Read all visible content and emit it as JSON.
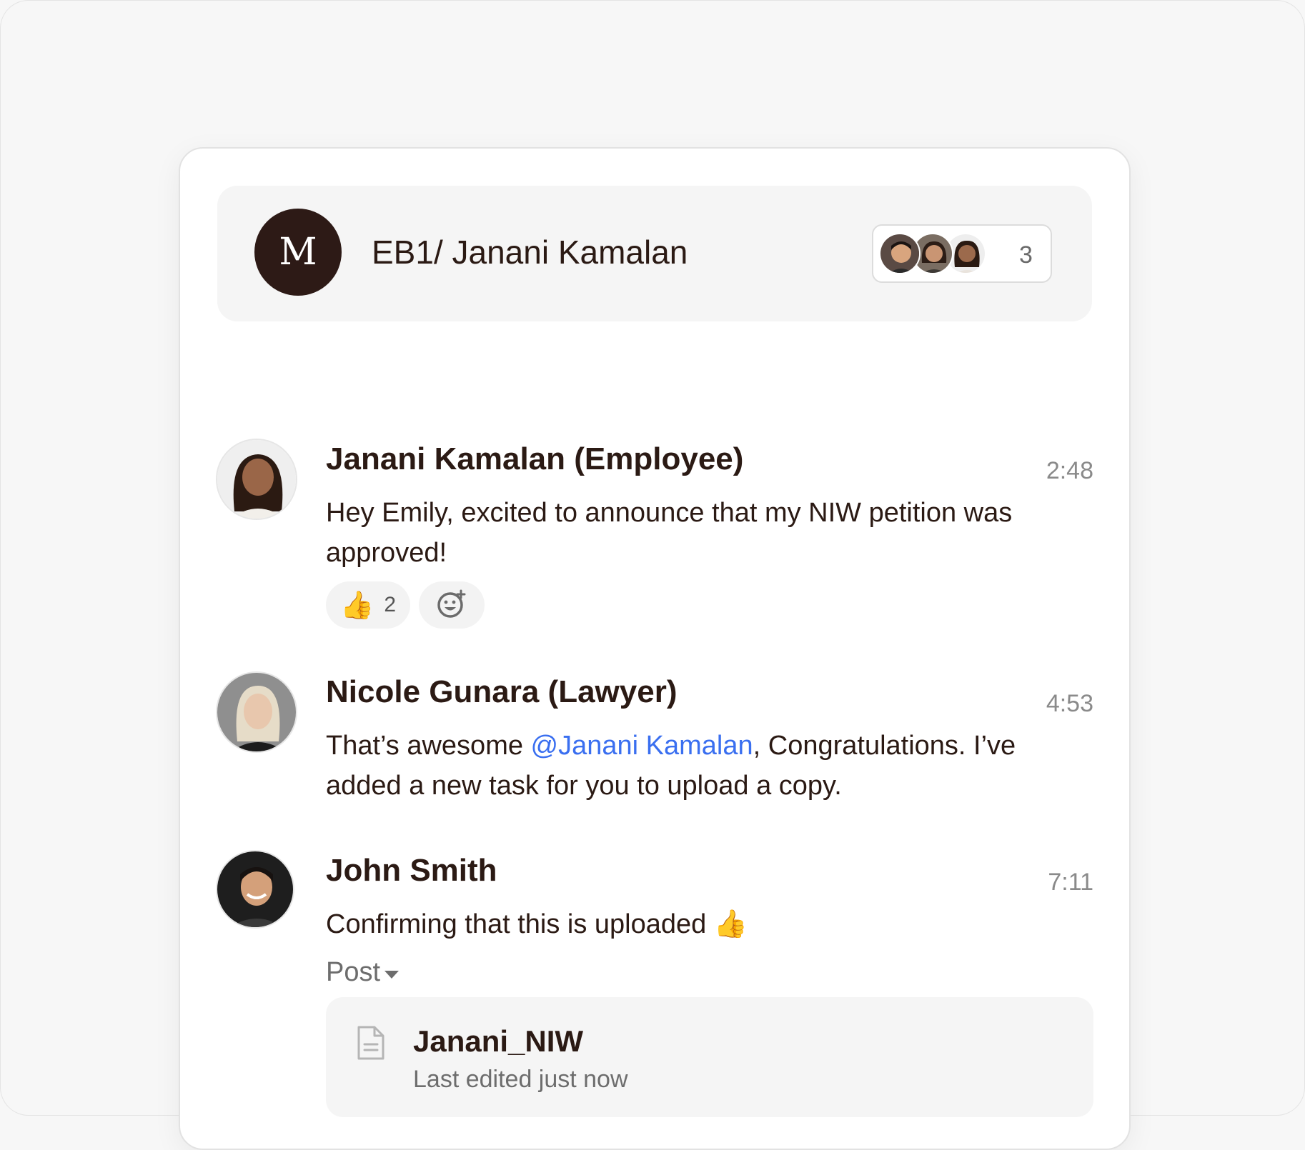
{
  "header": {
    "avatar_initial": "M",
    "title": "EB1/ Janani Kamalan",
    "member_count": "3"
  },
  "messages": [
    {
      "author": "Janani Kamalan (Employee)",
      "time": "2:48",
      "text": "Hey Emily, excited to announce that my NIW petition was approved!",
      "reactions": [
        {
          "emoji": "👍",
          "count": "2"
        }
      ]
    },
    {
      "author": "Nicole Gunara (Lawyer)",
      "time": "4:53",
      "text_before": "That’s awesome ",
      "mention": "@Janani Kamalan",
      "text_after": ", Congratulations. I’ve added a new task for you to upload a copy."
    },
    {
      "author": "John Smith",
      "time": "7:11",
      "text": "Confirming that this is uploaded 👍",
      "post_label": "Post",
      "attachment": {
        "name": "Janani_NIW",
        "meta": "Last edited just now"
      }
    }
  ],
  "colors": {
    "brand_dark": "#2d1a16",
    "mention": "#3a6ff0",
    "muted": "#8a8a8a"
  },
  "icons": [
    "add-reaction-icon",
    "document-icon",
    "caret-down-icon"
  ]
}
